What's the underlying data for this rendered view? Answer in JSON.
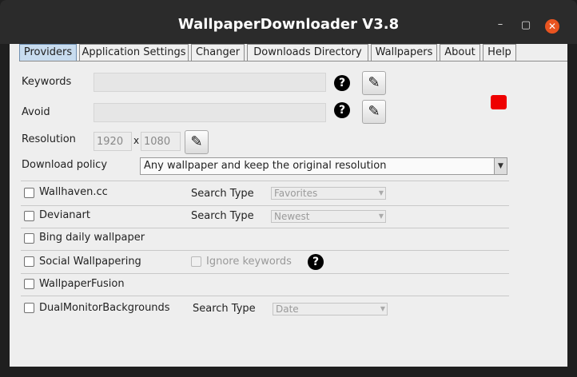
{
  "window": {
    "title": "WallpaperDownloader V3.8",
    "minimize": "–",
    "maximize": "▢",
    "close": "✕"
  },
  "tabs": [
    {
      "label": "Providers",
      "active": true
    },
    {
      "label": "Application Settings"
    },
    {
      "label": "Changer"
    },
    {
      "label": "Downloads Directory"
    },
    {
      "label": "Wallpapers"
    },
    {
      "label": "About"
    },
    {
      "label": "Help"
    }
  ],
  "form": {
    "keywords_label": "Keywords",
    "keywords_value": "",
    "avoid_label": "Avoid",
    "avoid_value": "",
    "resolution_label": "Resolution",
    "res_width": "1920",
    "res_sep": "x",
    "res_height": "1080",
    "policy_label": "Download policy",
    "policy_value": "Any wallpaper and keep the original resolution",
    "help_glyph": "?",
    "edit_glyph": "✎",
    "status_color": "#ee0000"
  },
  "providers": {
    "wallhaven": {
      "label": "Wallhaven.cc",
      "search_type_label": "Search Type",
      "search_type": "Favorites",
      "checked": false
    },
    "devianart": {
      "label": "Devianart",
      "search_type_label": "Search Type",
      "search_type": "Newest",
      "checked": false
    },
    "bing": {
      "label": "Bing daily wallpaper",
      "checked": false
    },
    "social": {
      "label": "Social Wallpapering",
      "ignore_keywords_label": "Ignore keywords",
      "checked": false
    },
    "wallpaperfusion": {
      "label": "WallpaperFusion",
      "checked": false
    },
    "dualmonitor": {
      "label": "DualMonitorBackgrounds",
      "search_type_label": "Search Type",
      "search_type": "Date",
      "checked": false
    }
  },
  "icons": {
    "combo_arrow": "▼",
    "policy_arrow": "▼"
  }
}
